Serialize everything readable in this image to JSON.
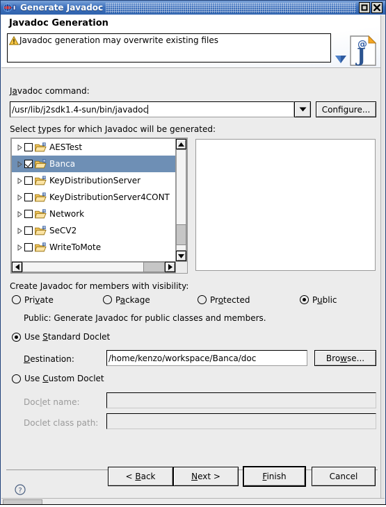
{
  "window": {
    "title": "Generate Javadoc",
    "icon": "globe-pin-icon",
    "maximize_label": "□",
    "close_label": "✖"
  },
  "header": {
    "title": "Javadoc Generation",
    "message": "Javadoc generation may overwrite existing files",
    "warning_icon": "warning-triangle-icon",
    "banner_icon": "javadoc-page-icon"
  },
  "command": {
    "label": "Javadoc command:",
    "value": "/usr/lib/j2sdk1.4-sun/bin/javadoc",
    "dropdown_icon": "▼",
    "configure_label": "Configure..."
  },
  "types": {
    "label": "Select types for which Javadoc will be generated:",
    "items": [
      {
        "name": "AESTest",
        "checked": false,
        "selected": false
      },
      {
        "name": "Banca",
        "checked": true,
        "selected": true
      },
      {
        "name": "KeyDistributionServer",
        "checked": false,
        "selected": false
      },
      {
        "name": "KeyDistributionServer4CONT",
        "checked": false,
        "selected": false
      },
      {
        "name": "Network",
        "checked": false,
        "selected": false
      },
      {
        "name": "SeCV2",
        "checked": false,
        "selected": false
      },
      {
        "name": "WriteToMote",
        "checked": false,
        "selected": false
      }
    ],
    "scroll_up_icon": "▲",
    "scroll_down_icon": "▼",
    "scroll_left_icon": "◀",
    "scroll_right_icon": "▶"
  },
  "visibility": {
    "label": "Create Javadoc for members with visibility:",
    "options": [
      {
        "label": "Private",
        "selected": false
      },
      {
        "label": "Package",
        "selected": false
      },
      {
        "label": "Protected",
        "selected": false
      },
      {
        "label": "Public",
        "selected": true
      }
    ],
    "description": "Public: Generate Javadoc for public classes and members."
  },
  "doclet": {
    "standard_label": "Use Standard Doclet",
    "standard_selected": true,
    "destination_label": "Destination:",
    "destination_value": "/home/kenzo/workspace/Banca/doc",
    "browse_label": "Browse...",
    "custom_label": "Use Custom Doclet",
    "custom_selected": false,
    "doclet_name_label": "Doclet name:",
    "doclet_name_value": "",
    "doclet_classpath_label": "Doclet class path:",
    "doclet_classpath_value": ""
  },
  "footer": {
    "help_icon": "help-question-icon",
    "back_label": "< Back",
    "next_label": "Next >",
    "finish_label": "Finish",
    "cancel_label": "Cancel"
  },
  "colors": {
    "titlebar_start": "#7ba3d8",
    "titlebar_end": "#2f62ad",
    "selection": "#6e8fb5",
    "dialog_bg": "#ececec",
    "accent_blue": "#3f72bd"
  }
}
